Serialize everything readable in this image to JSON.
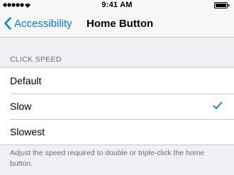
{
  "status_bar": {
    "time": "9:41 AM"
  },
  "nav": {
    "back_label": "Accessibility",
    "title": "Home Button"
  },
  "section": {
    "header": "CLICK SPEED"
  },
  "options": [
    {
      "label": "Default",
      "selected": false
    },
    {
      "label": "Slow",
      "selected": true
    },
    {
      "label": "Slowest",
      "selected": false
    }
  ],
  "footer": {
    "note": "Adjust the speed required to double or triple-click the home button."
  },
  "colors": {
    "accent": "#007aff",
    "background": "#efeff4",
    "secondary_text": "#6d6d72"
  },
  "icons": {
    "back": "chevron-left-icon",
    "selected": "checkmark-icon",
    "signal": "signal-icon",
    "battery": "battery-icon"
  }
}
